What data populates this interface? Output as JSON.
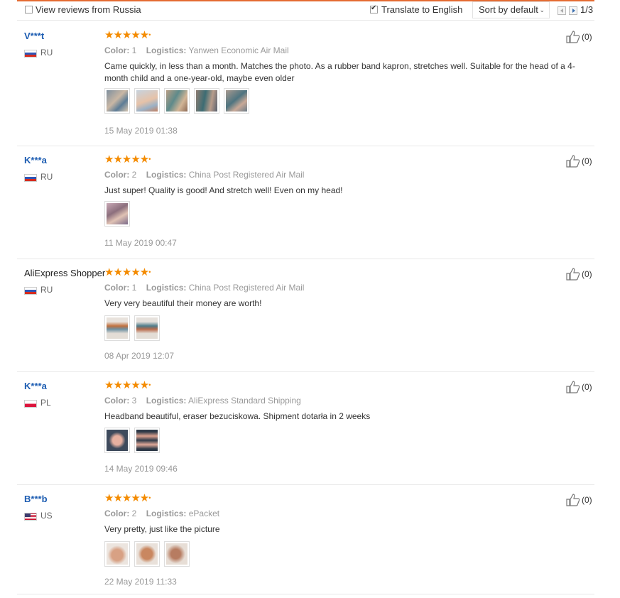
{
  "toolbar": {
    "view_russia": "View reviews from Russia",
    "translate": "Translate to English",
    "sort": "Sort by default",
    "page": "1/3"
  },
  "reviews": [
    {
      "user": "V***t",
      "country": "RU",
      "color_label": "Color:",
      "color": "1",
      "logistics_label": "Logistics:",
      "logistics": "Yanwen Economic Air Mail",
      "comment": "Came quickly, in less than a month. Matches the photo. As a rubber band kapron, stretches well. Suitable for the head of a 4-month child and a one-year-old, maybe even older",
      "date": "15 May 2019 01:38",
      "likes": "(0)"
    },
    {
      "user": "K***a",
      "country": "RU",
      "color_label": "Color:",
      "color": "2",
      "logistics_label": "Logistics:",
      "logistics": "China Post Registered Air Mail",
      "comment": "Just super! Quality is good! And stretch well! Even on my head!",
      "date": "11 May 2019 00:47",
      "likes": "(0)"
    },
    {
      "user": "AliExpress Shopper",
      "country": "RU",
      "color_label": "Color:",
      "color": "1",
      "logistics_label": "Logistics:",
      "logistics": "China Post Registered Air Mail",
      "comment": "Very very beautiful their money are worth!",
      "date": "08 Apr 2019 12:07",
      "likes": "(0)"
    },
    {
      "user": "K***a",
      "country": "PL",
      "color_label": "Color:",
      "color": "3",
      "logistics_label": "Logistics:",
      "logistics": "AliExpress Standard Shipping",
      "comment": "Headband beautiful, eraser bezuciskowa. Shipment dotarła in 2 weeks",
      "date": "14 May 2019 09:46",
      "likes": "(0)"
    },
    {
      "user": "B***b",
      "country": "US",
      "color_label": "Color:",
      "color": "2",
      "logistics_label": "Logistics:",
      "logistics": "ePacket",
      "comment": "Very pretty, just like the picture",
      "date": "22 May 2019 11:33",
      "likes": "(0)"
    }
  ],
  "colors": {
    "accent": "#e46b32",
    "star": "#f48b00",
    "username": "#1d5db2"
  },
  "icons": {
    "rating": "star-icon",
    "like": "thumbs-up-icon",
    "page_prev": "triangle-left-icon",
    "page_next": "triangle-right-icon"
  }
}
